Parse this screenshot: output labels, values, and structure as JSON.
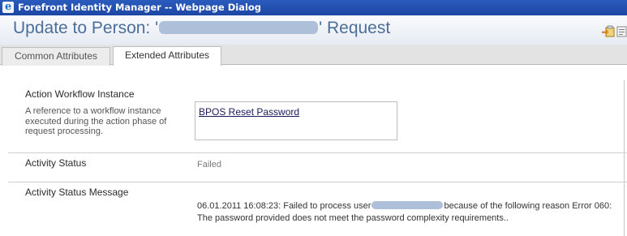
{
  "window": {
    "title": "Forefront Identity Manager -- Webpage Dialog"
  },
  "header": {
    "title_prefix": "Update to Person: '",
    "title_suffix": "' Request",
    "icons": [
      "export-icon",
      "scroll-icon"
    ]
  },
  "tabs": [
    {
      "label": "Common Attributes",
      "selected": false
    },
    {
      "label": "Extended Attributes",
      "selected": true
    }
  ],
  "fields": {
    "workflow": {
      "label": "Action Workflow Instance",
      "description": "A reference to a workflow instance executed during the action phase of request processing.",
      "value": "BPOS Reset Password"
    },
    "status": {
      "label": "Activity Status",
      "value": "Failed"
    },
    "message": {
      "label": "Activity Status Message",
      "value_part1": "06.01.2011 16:08:23: Failed to process user",
      "value_part2": "because of the following reason Error 060:",
      "value_line2": "The password provided does not meet the password complexity requirements.."
    }
  },
  "colors": {
    "titlebar": "#1d46a4",
    "page_title": "#4b6f99",
    "redaction": "#aebfda"
  }
}
